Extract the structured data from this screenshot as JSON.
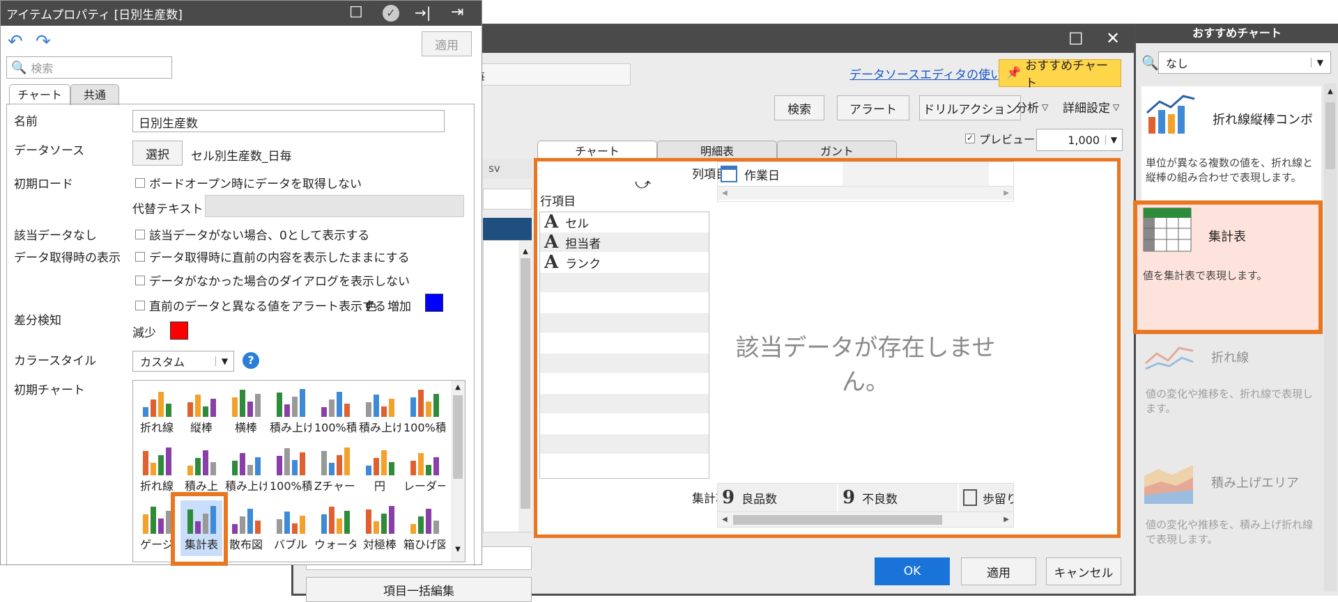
{
  "main": {
    "datasource_value": "毎",
    "help_link": "データソースエディタの使い方",
    "recommend_button": "おすすめチャート",
    "toolbar": {
      "search": "検索",
      "alert": "アラート",
      "drill": "ドリルアクション",
      "analysis": "分析",
      "advanced": "詳細設定"
    },
    "preview_label": "プレビュー",
    "preview_count": "1,000",
    "left_fragment": "sv",
    "tabs": [
      "チャート",
      "明細表",
      "ガント"
    ],
    "editor": {
      "column_label": "列項目",
      "row_label": "行項目",
      "summary_label": "集計項目",
      "column_items": [
        "作業日"
      ],
      "row_items": [
        "セル",
        "担当者",
        "ランク"
      ],
      "summary_items": [
        "良品数",
        "不良数",
        "歩留り"
      ],
      "no_data": "該当データが存在しません。"
    },
    "bottom_fragment": "項目一括編集",
    "buttons": {
      "ok": "OK",
      "apply": "適用",
      "cancel": "キャンセル"
    }
  },
  "recommend": {
    "title": "おすすめチャート",
    "search_value": "なし",
    "items": [
      {
        "title": "折れ線縦棒コンボ",
        "desc": "単位が異なる複数の値を、折れ線と縦棒の組み合わせで表現します。"
      },
      {
        "title": "集計表",
        "desc": "値を集計表で表現します。"
      },
      {
        "title": "折れ線",
        "desc": "値の変化や推移を、折れ線で表現します。"
      },
      {
        "title": "積み上げエリア",
        "desc": "値の変化や推移を、積み上げ折れ線で表現します。"
      }
    ]
  },
  "prop": {
    "title": "アイテムプロパティ [日別生産数]",
    "apply": "適用",
    "search_placeholder": "検索",
    "tabs": [
      "チャート",
      "共通"
    ],
    "labels": {
      "name": "名前",
      "datasource": "データソース",
      "initial_load": "初期ロード",
      "no_data": "該当データなし",
      "fetch_display": "データ取得時の表示",
      "diff": "差分検知",
      "color_style": "カラースタイル",
      "initial_chart": "初期チャート"
    },
    "name_value": "日別生産数",
    "select_button": "選択",
    "datasource_value": "セル別生産数_日毎",
    "opt_board_open": "ボードオープン時にデータを取得しない",
    "alt_text_label": "代替テキスト",
    "opt_zero": "該当データがない場合、0として表示する",
    "opt_keep": "データ取得時に直前の内容を表示したままにする",
    "opt_no_dialog": "データがなかった場合のダイアログを表示しない",
    "opt_alert": "直前のデータと異なる値をアラート表示する",
    "color_label": "色",
    "increase_label": "増加",
    "decrease_label": "減少",
    "colors": {
      "increase": "#0000ff",
      "decrease": "#ff0000"
    },
    "color_style_value": "カスタム",
    "charts": [
      "折れ線",
      "縦棒",
      "横棒",
      "積み上げ",
      "100%積",
      "積み上げ",
      "100%積",
      "折れ線",
      "積み上",
      "積み上げ",
      "100%積",
      "Zチャート",
      "円",
      "レーダー",
      "ゲージ",
      "集計表",
      "散布図",
      "バブル",
      "ウォーター",
      "対極棒",
      "箱ひげ図"
    ]
  }
}
